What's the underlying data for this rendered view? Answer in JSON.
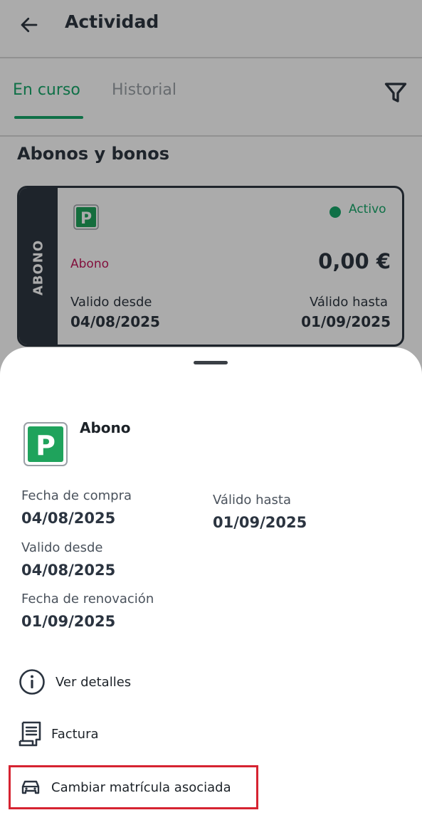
{
  "appbar": {
    "title": "Actividad"
  },
  "tabs": [
    {
      "label": "En curso",
      "active": true
    },
    {
      "label": "Historial",
      "active": false
    }
  ],
  "section": {
    "title": "Abonos y bonos"
  },
  "card": {
    "side_label": "ABONO",
    "status": "Activo",
    "type": "Abono",
    "price": "0,00 €",
    "valid_from_label": "Valido desde",
    "valid_from": "04/08/2025",
    "valid_to_label": "Válido hasta",
    "valid_to": "01/09/2025"
  },
  "sheet": {
    "title": "Abono",
    "fields": {
      "purchase_date_label": "Fecha de compra",
      "purchase_date": "04/08/2025",
      "valid_to_label": "Válido hasta",
      "valid_to": "01/09/2025",
      "valid_from_label": "Valido desde",
      "valid_from": "04/08/2025",
      "renewal_label": "Fecha de renovación",
      "renewal_date": "01/09/2025"
    },
    "actions": {
      "details": "Ver detalles",
      "invoice": "Factura",
      "change_plate": "Cambiar matrícula asociada"
    }
  },
  "icons": {
    "back": "arrow-left-icon",
    "filter": "funnel-icon",
    "parking": "parking-p-icon",
    "info": "info-circle-icon",
    "invoice": "receipt-icon",
    "car": "car-icon"
  },
  "colors": {
    "accent_green": "#17a86a",
    "dark": "#2e3640",
    "type_pink": "#c2185b",
    "highlight_red": "#d62331"
  }
}
